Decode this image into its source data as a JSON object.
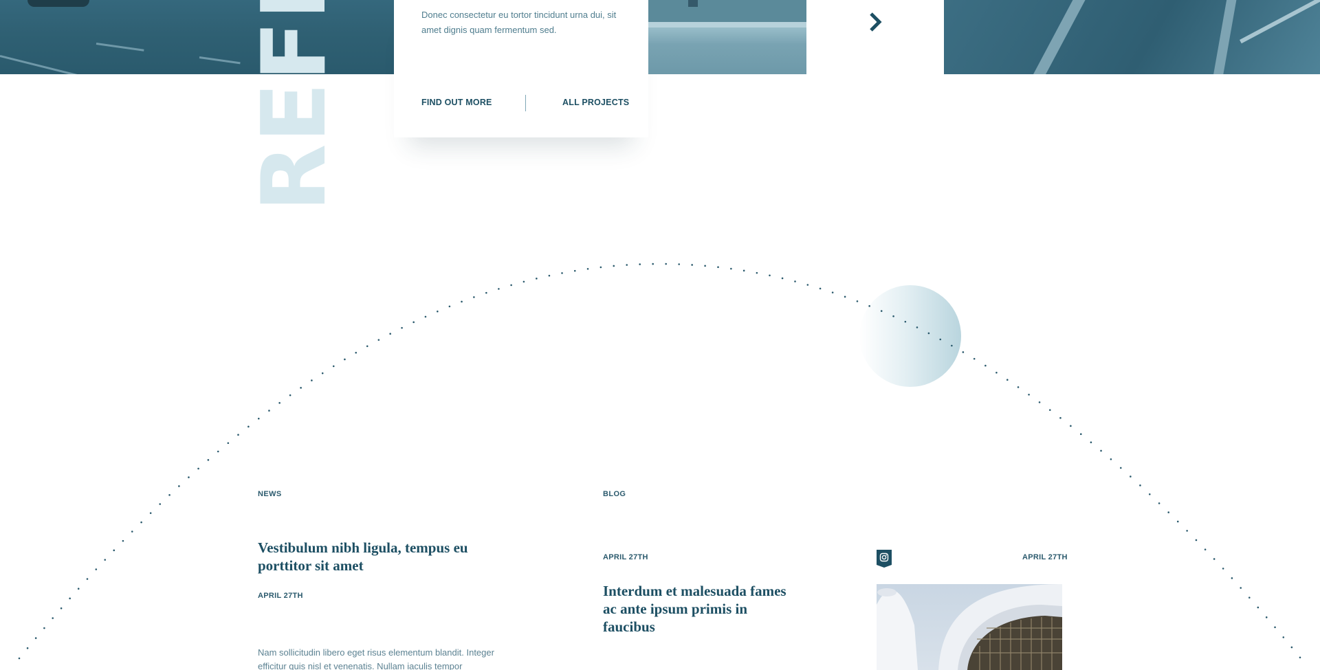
{
  "vertical_word": "REFE",
  "project_card": {
    "description": "Donec consectetur eu tortor tincidunt urna dui, sit amet dignis quam fermentum sed.",
    "find_out_more": "FIND OUT MORE",
    "all_projects": "ALL PROJECTS"
  },
  "slider": {
    "next_icon": "chevron-right-icon"
  },
  "news": {
    "label": "NEWS",
    "title": "Vestibulum nibh ligula, tempus eu porttitor sit amet",
    "date": "APRIL 27TH",
    "excerpt": "Nam sollicitudin libero eget risus elementum blandit. Integer efficitur quis nisl et venenatis. Nullam iaculis tempor molestie"
  },
  "blog": {
    "label": "BLOG",
    "date": "APRIL 27TH",
    "title": "Interdum et malesuada fames ac ante ipsum primis in faucibus"
  },
  "instagram": {
    "icon": "instagram-icon",
    "date": "APRIL 27TH"
  },
  "colors": {
    "accent": "#1d4f63",
    "watermark": "#d6e8ee",
    "photo_tint": "#2f6073"
  }
}
